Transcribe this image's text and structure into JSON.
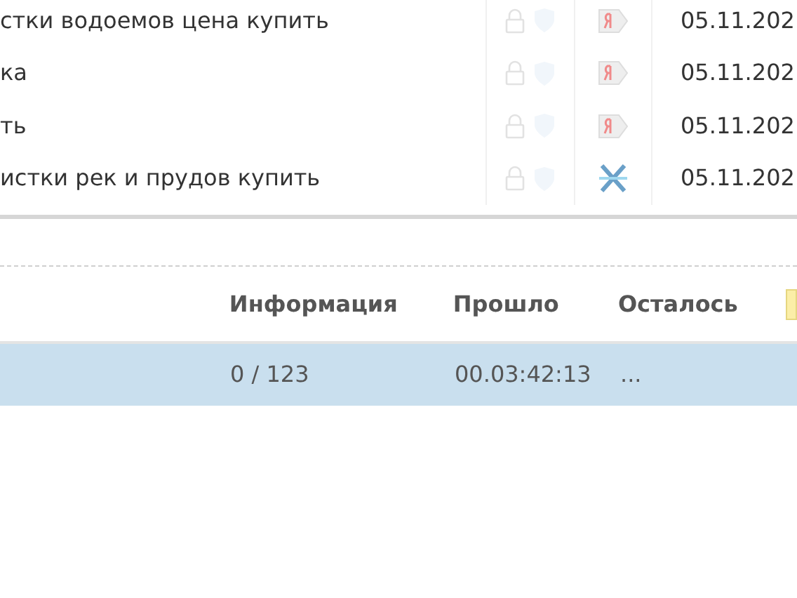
{
  "keywords": {
    "rows": [
      {
        "phrase": "стки водоемов цена купить",
        "kind": "yandex",
        "date": "05.11.202"
      },
      {
        "phrase": "ка",
        "kind": "yandex",
        "date": "05.11.202"
      },
      {
        "phrase": "ть",
        "kind": "yandex",
        "date": "05.11.202"
      },
      {
        "phrase": "истки рек и прудов купить",
        "kind": "cross",
        "date": "05.11.202"
      }
    ]
  },
  "tasks": {
    "columns": [
      "Информация",
      "Прошло",
      "Осталось"
    ],
    "rows": [
      {
        "selected": true,
        "info": "0 / 123",
        "elapsed": "00.03:42:13",
        "remaining": "..."
      }
    ]
  }
}
